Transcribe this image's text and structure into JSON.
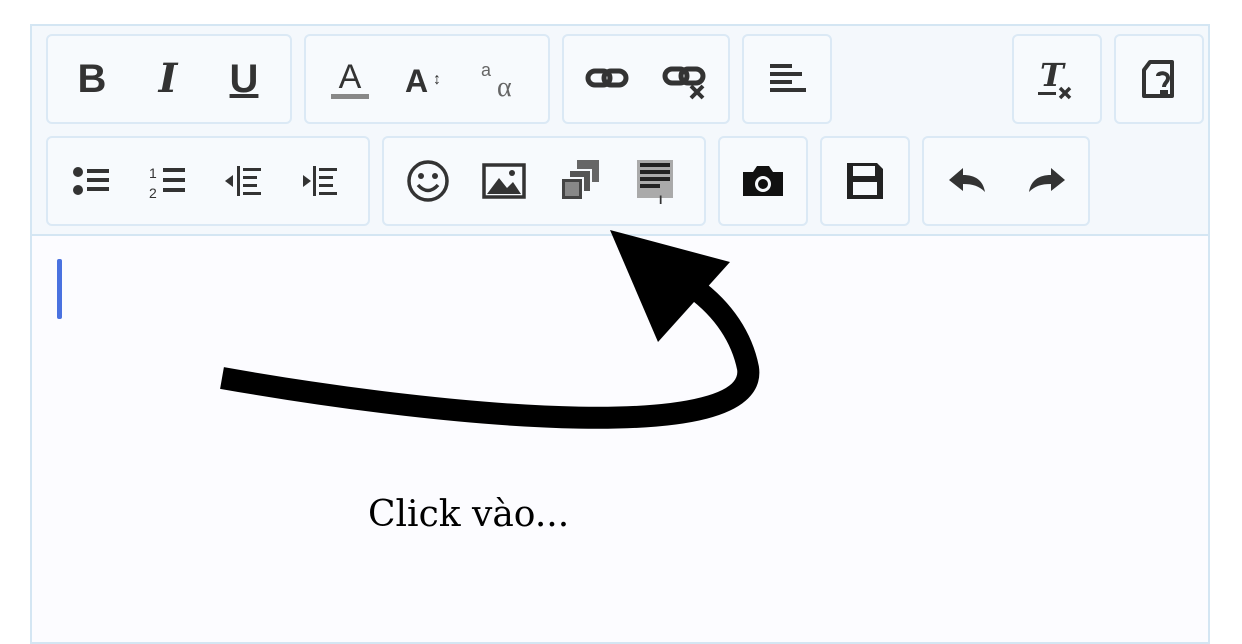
{
  "toolbar": {
    "row1": [
      {
        "name": "bold-button",
        "label": "B"
      },
      {
        "name": "italic-button",
        "label": "I"
      },
      {
        "name": "underline-button",
        "label": "U"
      },
      {
        "name": "font-color-button",
        "icon": "font-color-icon"
      },
      {
        "name": "font-size-button",
        "icon": "font-size-icon"
      },
      {
        "name": "font-family-button",
        "icon": "font-family-icon"
      },
      {
        "name": "insert-link-button",
        "icon": "link-icon"
      },
      {
        "name": "remove-link-button",
        "icon": "unlink-icon"
      },
      {
        "name": "align-button",
        "icon": "align-left-icon"
      },
      {
        "name": "clear-format-button",
        "icon": "clear-format-icon"
      },
      {
        "name": "source-button",
        "icon": "source-code-icon"
      }
    ],
    "row2": [
      {
        "name": "bullet-list-button",
        "icon": "bulleted-list-icon"
      },
      {
        "name": "numbered-list-button",
        "icon": "numbered-list-icon"
      },
      {
        "name": "outdent-button",
        "icon": "outdent-icon"
      },
      {
        "name": "indent-button",
        "icon": "indent-icon"
      },
      {
        "name": "smilie-button",
        "icon": "smiley-icon"
      },
      {
        "name": "image-button",
        "icon": "image-icon"
      },
      {
        "name": "media-button",
        "icon": "media-icon"
      },
      {
        "name": "template-button",
        "icon": "template-icon"
      },
      {
        "name": "camera-button",
        "icon": "camera-icon"
      },
      {
        "name": "save-draft-button",
        "icon": "save-icon"
      },
      {
        "name": "undo-button",
        "icon": "undo-icon"
      },
      {
        "name": "redo-button",
        "icon": "redo-icon"
      }
    ]
  },
  "content": {
    "annotation": "Click vào..."
  },
  "colors": {
    "border": "#d4e6f3",
    "toolbar_bg": "#f4f8fc",
    "caret": "#4a72e0",
    "icon": "#333333"
  }
}
